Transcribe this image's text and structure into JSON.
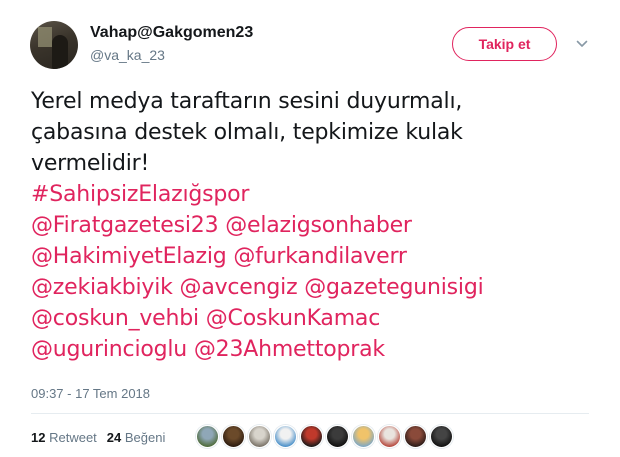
{
  "user": {
    "display_name": "Vahap@Gakgomen23",
    "handle": "@va_ka_23"
  },
  "follow_button": {
    "label": "Takip et"
  },
  "tweet": {
    "lines": [
      [
        {
          "t": "Yerel medya taraftarın sesini duyurmalı,",
          "link": false
        }
      ],
      [
        {
          "t": "çabasına destek olmalı, tepkimize kulak",
          "link": false
        }
      ],
      [
        {
          "t": "vermelidir!",
          "link": false
        }
      ],
      [
        {
          "t": "#SahipsizElazığspor",
          "link": true
        }
      ],
      [
        {
          "t": "@Firatgazetesi23",
          "link": true
        },
        {
          "t": " ",
          "link": false
        },
        {
          "t": "@elazigsonhaber",
          "link": true
        }
      ],
      [
        {
          "t": "@HakimiyetElazig",
          "link": true
        },
        {
          "t": "  ",
          "link": false
        },
        {
          "t": "@furkandilaverr",
          "link": true
        }
      ],
      [
        {
          "t": "@zekiakbiyik",
          "link": true
        },
        {
          "t": "  ",
          "link": false
        },
        {
          "t": "@avcengiz",
          "link": true
        },
        {
          "t": " ",
          "link": false
        },
        {
          "t": "@gazetegunisigi",
          "link": true
        }
      ],
      [
        {
          "t": "@coskun_vehbi",
          "link": true
        },
        {
          "t": "  ",
          "link": false
        },
        {
          "t": "@CoskunKamac",
          "link": true
        }
      ],
      [
        {
          "t": "@ugurincioglu",
          "link": true
        },
        {
          "t": "  ",
          "link": false
        },
        {
          "t": "@23Ahmettoprak",
          "link": true
        }
      ]
    ],
    "timestamp": "09:37 - 17 Tem 2018"
  },
  "stats": {
    "retweet_count": "12",
    "retweet_label": "Retweet",
    "like_count": "24",
    "like_label": "Beğeni"
  },
  "colors": {
    "accent": "#e0245e",
    "muted": "#657786",
    "text": "#14171a"
  },
  "liker_avatars": [
    {
      "icon": "avatar-landscape",
      "c1": "#8fa7b7",
      "c2": "#4f6b3b"
    },
    {
      "icon": "avatar-portrait",
      "c1": "#6b4a2a",
      "c2": "#2d1c10"
    },
    {
      "icon": "avatar-portrait",
      "c1": "#d8d4cc",
      "c2": "#7a7368"
    },
    {
      "icon": "avatar-sticker",
      "c1": "#f1f1f1",
      "c2": "#4a90c9"
    },
    {
      "icon": "avatar-logo",
      "c1": "#c0392b",
      "c2": "#1a1a1a"
    },
    {
      "icon": "avatar-portrait",
      "c1": "#3b3b3b",
      "c2": "#101010"
    },
    {
      "icon": "avatar-sunset",
      "c1": "#f0c36a",
      "c2": "#7fa8c4"
    },
    {
      "icon": "avatar-group",
      "c1": "#e9e4df",
      "c2": "#b54a3f"
    },
    {
      "icon": "avatar-portrait",
      "c1": "#8a4a3a",
      "c2": "#2b1b18"
    },
    {
      "icon": "avatar-dark",
      "c1": "#444444",
      "c2": "#111111"
    }
  ]
}
